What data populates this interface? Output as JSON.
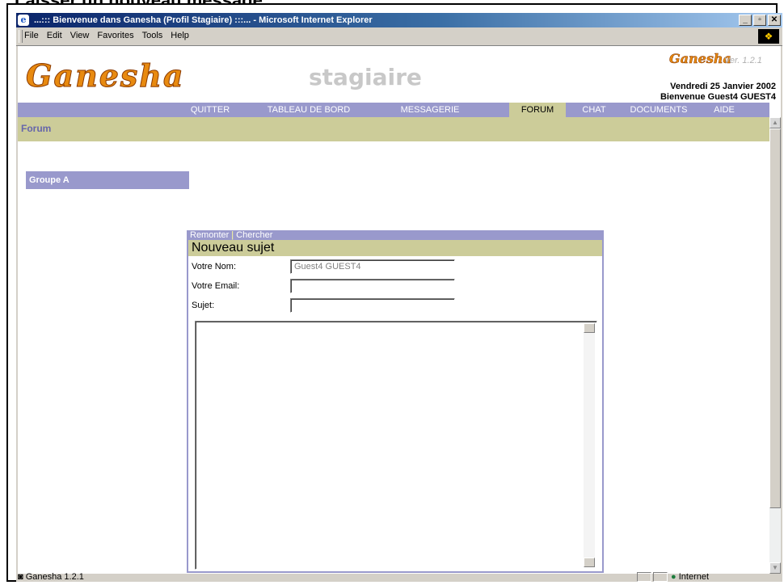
{
  "caption": "Laisser un nouveau message",
  "window": {
    "title": "...::: Bienvenue dans Ganesha (Profil Stagiaire) :::... - Microsoft Internet Explorer",
    "buttons": [
      "_",
      "▫",
      "✕"
    ]
  },
  "menubar": {
    "items": [
      "File",
      "Edit",
      "View",
      "Favorites",
      "Tools",
      "Help"
    ]
  },
  "header": {
    "logo": "Ganesha",
    "profile": "stagiaire",
    "small_logo": "Ganesha",
    "version": "Ver. 1.2.1",
    "date": "Vendredi 25 Janvier 2002",
    "welcome": "Bienvenue Guest4 GUEST4"
  },
  "nav": {
    "items": [
      "QUITTER",
      "TABLEAU DE BORD",
      "MESSAGERIE",
      "FORUM",
      "CHAT",
      "DOCUMENTS",
      "AIDE"
    ],
    "active": "FORUM"
  },
  "section": {
    "title": "Forum"
  },
  "group": {
    "label": "Groupe A"
  },
  "form": {
    "link_up": "Remonter",
    "link_sep": "|",
    "link_search": "Chercher",
    "heading": "Nouveau sujet",
    "name_label": "Votre Nom:",
    "name_value": "Guest4 GUEST4",
    "email_label": "Votre Email:",
    "email_value": "",
    "subject_label": "Sujet:",
    "subject_value": ""
  },
  "status": {
    "text": "Ganesha 1.2.1",
    "zone": "Internet"
  }
}
